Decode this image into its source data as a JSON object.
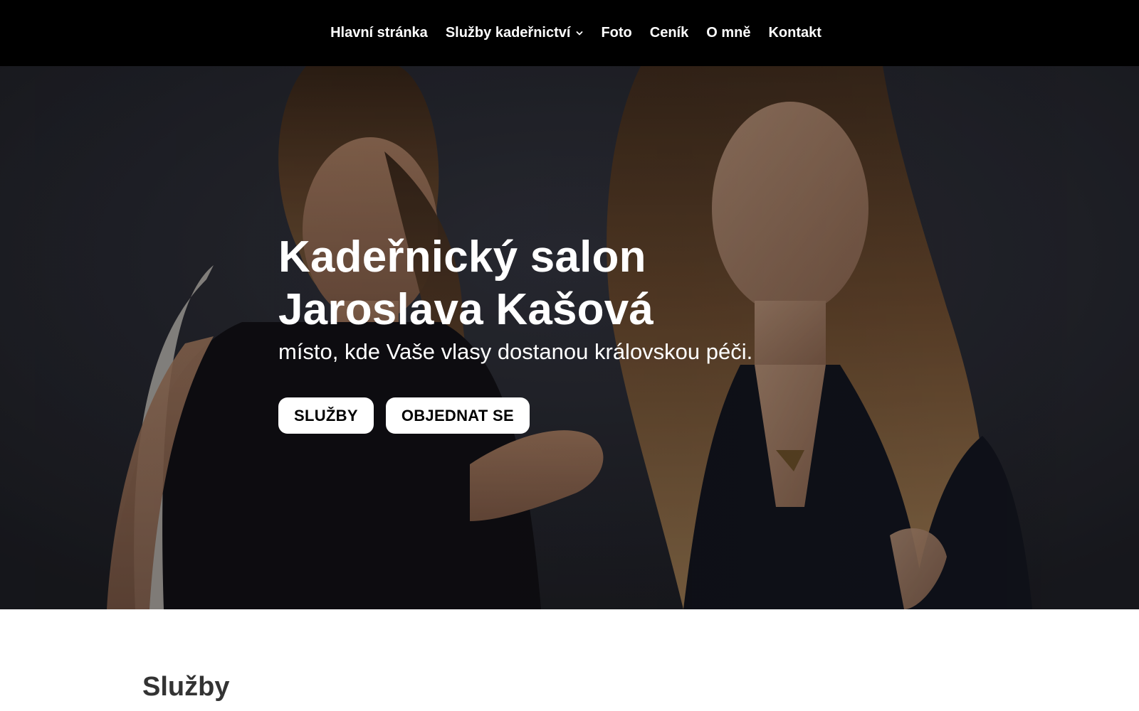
{
  "nav": {
    "items": [
      {
        "label": "Hlavní stránka",
        "has_dropdown": false
      },
      {
        "label": "Služby kadeřnictví",
        "has_dropdown": true
      },
      {
        "label": "Foto",
        "has_dropdown": false
      },
      {
        "label": "Ceník",
        "has_dropdown": false
      },
      {
        "label": "O mně",
        "has_dropdown": false
      },
      {
        "label": "Kontakt",
        "has_dropdown": false
      }
    ],
    "chevron_icon": "chevron-down-icon"
  },
  "hero": {
    "title_line1": "Kadeřnický salon",
    "title_line2": "Jaroslava Kašová",
    "subtitle": "místo, kde Vaše vlasy dostanou královskou péči.",
    "buttons": [
      {
        "label": "SLUŽBY"
      },
      {
        "label": "OBJEDNAT SE"
      }
    ]
  },
  "services": {
    "title": "Služby"
  },
  "colors": {
    "nav_bg": "#000000",
    "nav_text": "#ffffff",
    "hero_bg": "#24252d",
    "button_bg": "#ffffff",
    "button_text": "#000000",
    "section_title": "#333333"
  }
}
